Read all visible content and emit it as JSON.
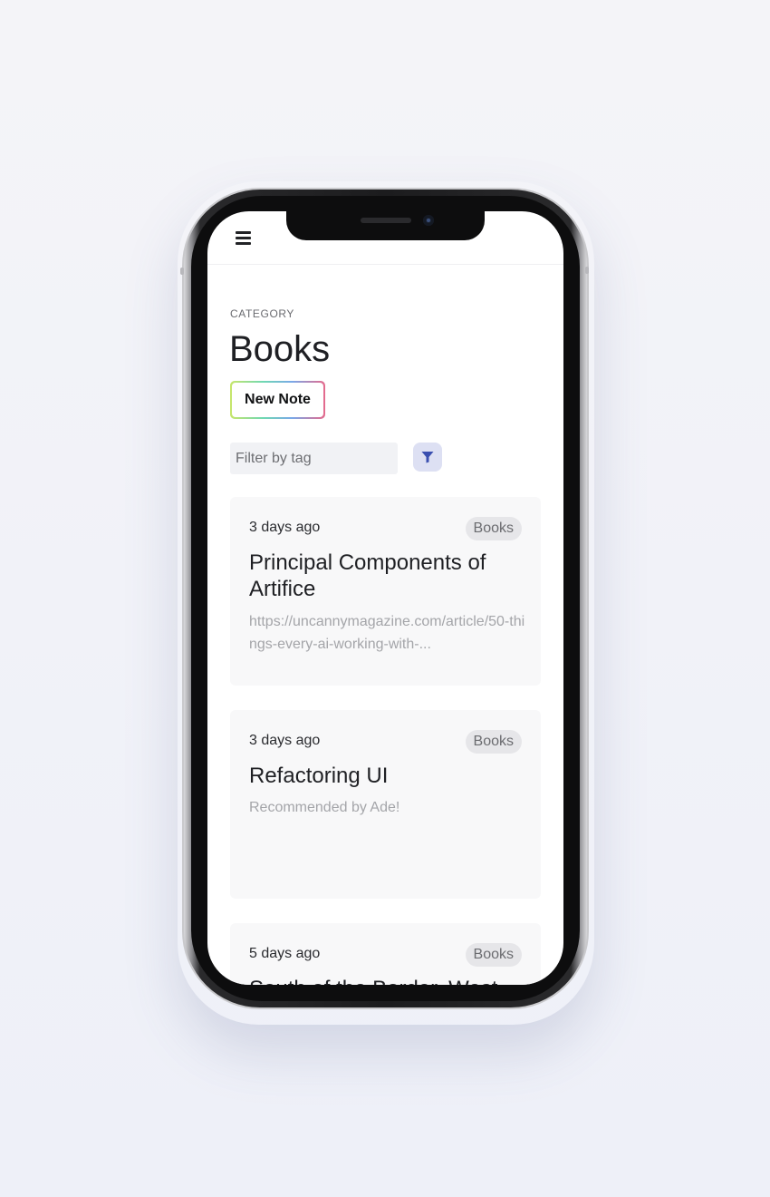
{
  "header": {
    "menu_icon": "hamburger-menu-icon"
  },
  "category": {
    "label": "CATEGORY",
    "title": "Books"
  },
  "actions": {
    "new_note_label": "New Note"
  },
  "filter": {
    "placeholder": "Filter by tag",
    "value": "",
    "filter_icon": "funnel-icon"
  },
  "notes": [
    {
      "date": "3 days ago",
      "tag": "Books",
      "title": "Principal Components of Artifice",
      "description": "https://uncannymagazine.com/article/50-things-every-ai-working-with-..."
    },
    {
      "date": "3 days ago",
      "tag": "Books",
      "title": "Refactoring UI",
      "description": "Recommended by Ade!"
    },
    {
      "date": "5 days ago",
      "tag": "Books",
      "title": "South of the Border, West",
      "description": ""
    }
  ],
  "colors": {
    "accent_filter_bg": "#dde0f3",
    "accent_filter_icon": "#3a4fb0",
    "card_bg": "#f8f8f9",
    "tag_bg": "#e6e6e9"
  }
}
